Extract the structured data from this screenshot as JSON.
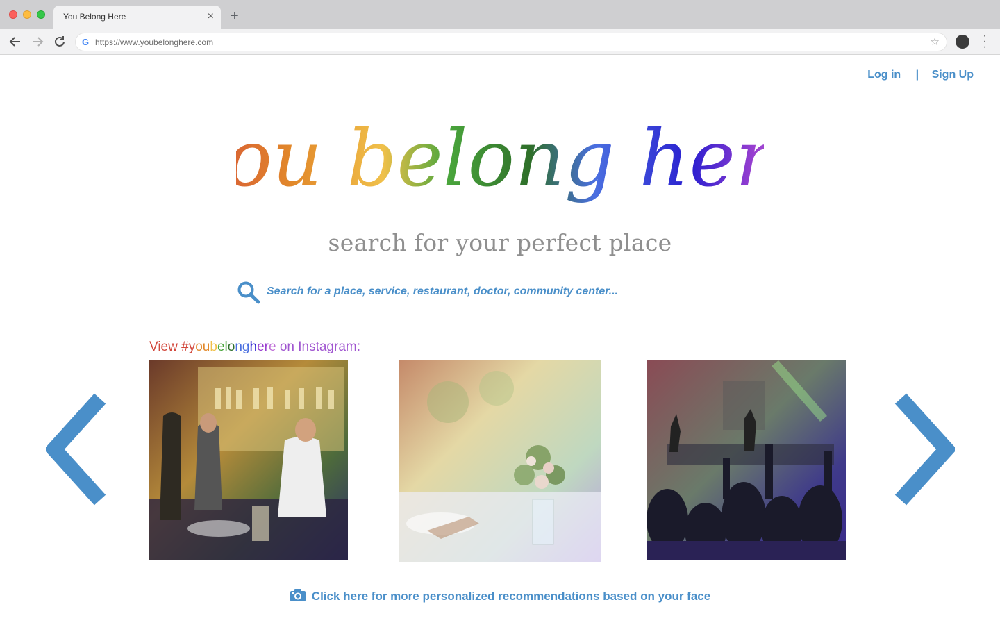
{
  "browser": {
    "tab_title": "You Belong Here",
    "url": "https://www.youbelonghere.com"
  },
  "auth": {
    "login": "Log in",
    "separator": "|",
    "signup": "Sign Up"
  },
  "hero": {
    "logo_text": "you belong here",
    "tagline": "search for your perfect place"
  },
  "search": {
    "placeholder": "Search for a place, service, restaurant, doctor, community center..."
  },
  "instagram": {
    "label_prefix": "View ",
    "hashtag": "#youbelonghere",
    "label_suffix": " on Instagram:"
  },
  "carousel": {
    "photos": [
      "bar bartenders photo",
      "floral table setting photo",
      "concert crowd photo"
    ],
    "prev_icon": "chevron-left-icon",
    "next_icon": "chevron-right-icon"
  },
  "face_cta": {
    "before": "Click ",
    "link": "here",
    "after": " for more personalized recommendations based on your face"
  },
  "colors": {
    "accent": "#4a8fc9",
    "tagline": "#8f8f8f",
    "rainbow": [
      "#d2473b",
      "#e2892a",
      "#f0c04a",
      "#4aa63c",
      "#2f6f2a",
      "#4a6fe0",
      "#2a1fd0",
      "#9a3fd0",
      "#c070d8"
    ]
  }
}
